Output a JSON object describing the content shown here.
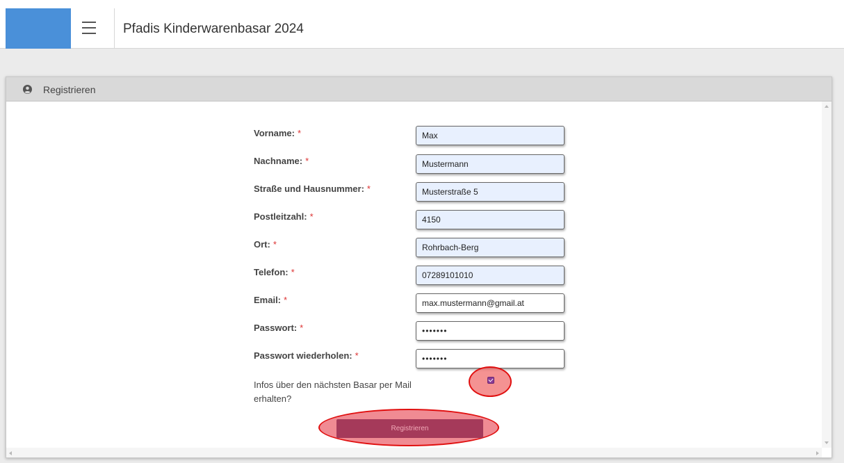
{
  "header": {
    "title": "Pfadis Kinderwarenbasar 2024",
    "menu_icon": "hamburger-menu-icon",
    "brand_color": "#4a90d9"
  },
  "panel": {
    "title": "Registrieren",
    "icon": "user-circle-icon"
  },
  "form": {
    "required_marker": "*",
    "fields": [
      {
        "label": "Vorname:",
        "value": "Max"
      },
      {
        "label": "Nachname:",
        "value": "Mustermann"
      },
      {
        "label": "Straße und Hausnummer:",
        "value": "Musterstraße 5"
      },
      {
        "label": "Postleitzahl:",
        "value": "4150"
      },
      {
        "label": "Ort:",
        "value": "Rohrbach-Berg"
      },
      {
        "label": "Telefon:",
        "value": "07289101010"
      },
      {
        "label": "Email:",
        "value": "max.mustermann@gmail.at"
      },
      {
        "label": "Passwort:",
        "value": "•••••••"
      },
      {
        "label": "Passwort wiederholen:",
        "value": "•••••••"
      }
    ],
    "newsletter_label": "Infos über den nächsten Basar per Mail erhalten?",
    "newsletter_checked": true,
    "submit_label": "Registrieren"
  },
  "colors": {
    "autofill_bg": "#e8f0fe",
    "button_bg": "#a53a5a",
    "highlight_red": "#e01010",
    "required_red": "#d33333"
  }
}
